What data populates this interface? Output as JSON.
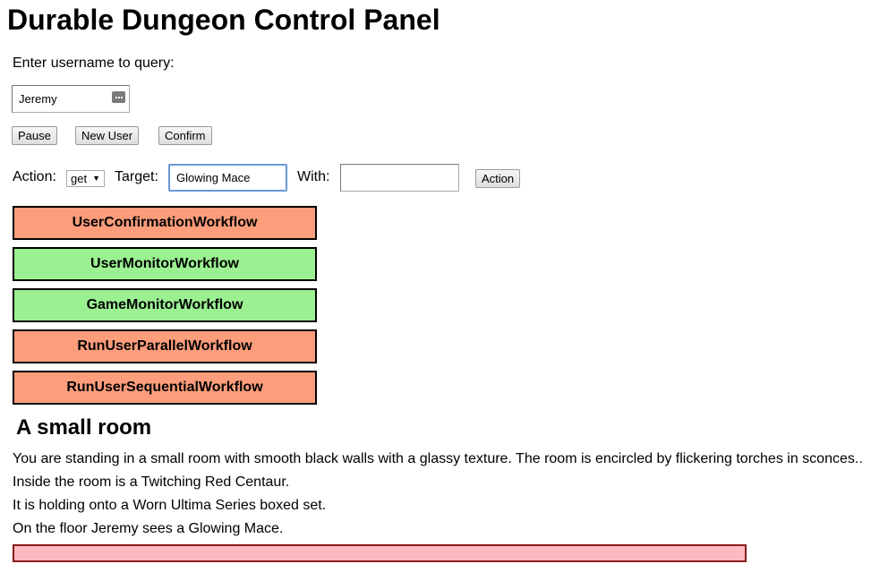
{
  "page_title": "Durable Dungeon Control Panel",
  "query": {
    "label": "Enter username to query:",
    "username_value": "Jeremy"
  },
  "buttons": {
    "pause": "Pause",
    "new_user": "New User",
    "confirm": "Confirm"
  },
  "action_bar": {
    "action_label": "Action:",
    "action_selected": "get",
    "target_label": "Target:",
    "target_value": "Glowing Mace",
    "with_label": "With:",
    "with_value": "",
    "action_button": "Action"
  },
  "workflows": [
    {
      "label": "UserConfirmationWorkflow",
      "status_color": "#fd9d7b"
    },
    {
      "label": "UserMonitorWorkflow",
      "status_color": "#9bf092"
    },
    {
      "label": "GameMonitorWorkflow",
      "status_color": "#9bf092"
    },
    {
      "label": "RunUserParallelWorkflow",
      "status_color": "#fd9d7b"
    },
    {
      "label": "RunUserSequentialWorkflow",
      "status_color": "#fd9d7b"
    }
  ],
  "room": {
    "title": "A small room",
    "lines": [
      "You are standing in a small room with smooth black walls with a glassy texture. The room is encircled by flickering torches in sconces..",
      "Inside the room is a Twitching Red Centaur.",
      "It is holding onto a Worn Ultima Series boxed set.",
      "On the floor Jeremy sees a Glowing Mace."
    ]
  },
  "message_bar": {
    "text": "",
    "color": "#fbbac1"
  },
  "icons": {
    "username_field": "autofill-key-icon",
    "select": "chevron-down-icon"
  }
}
